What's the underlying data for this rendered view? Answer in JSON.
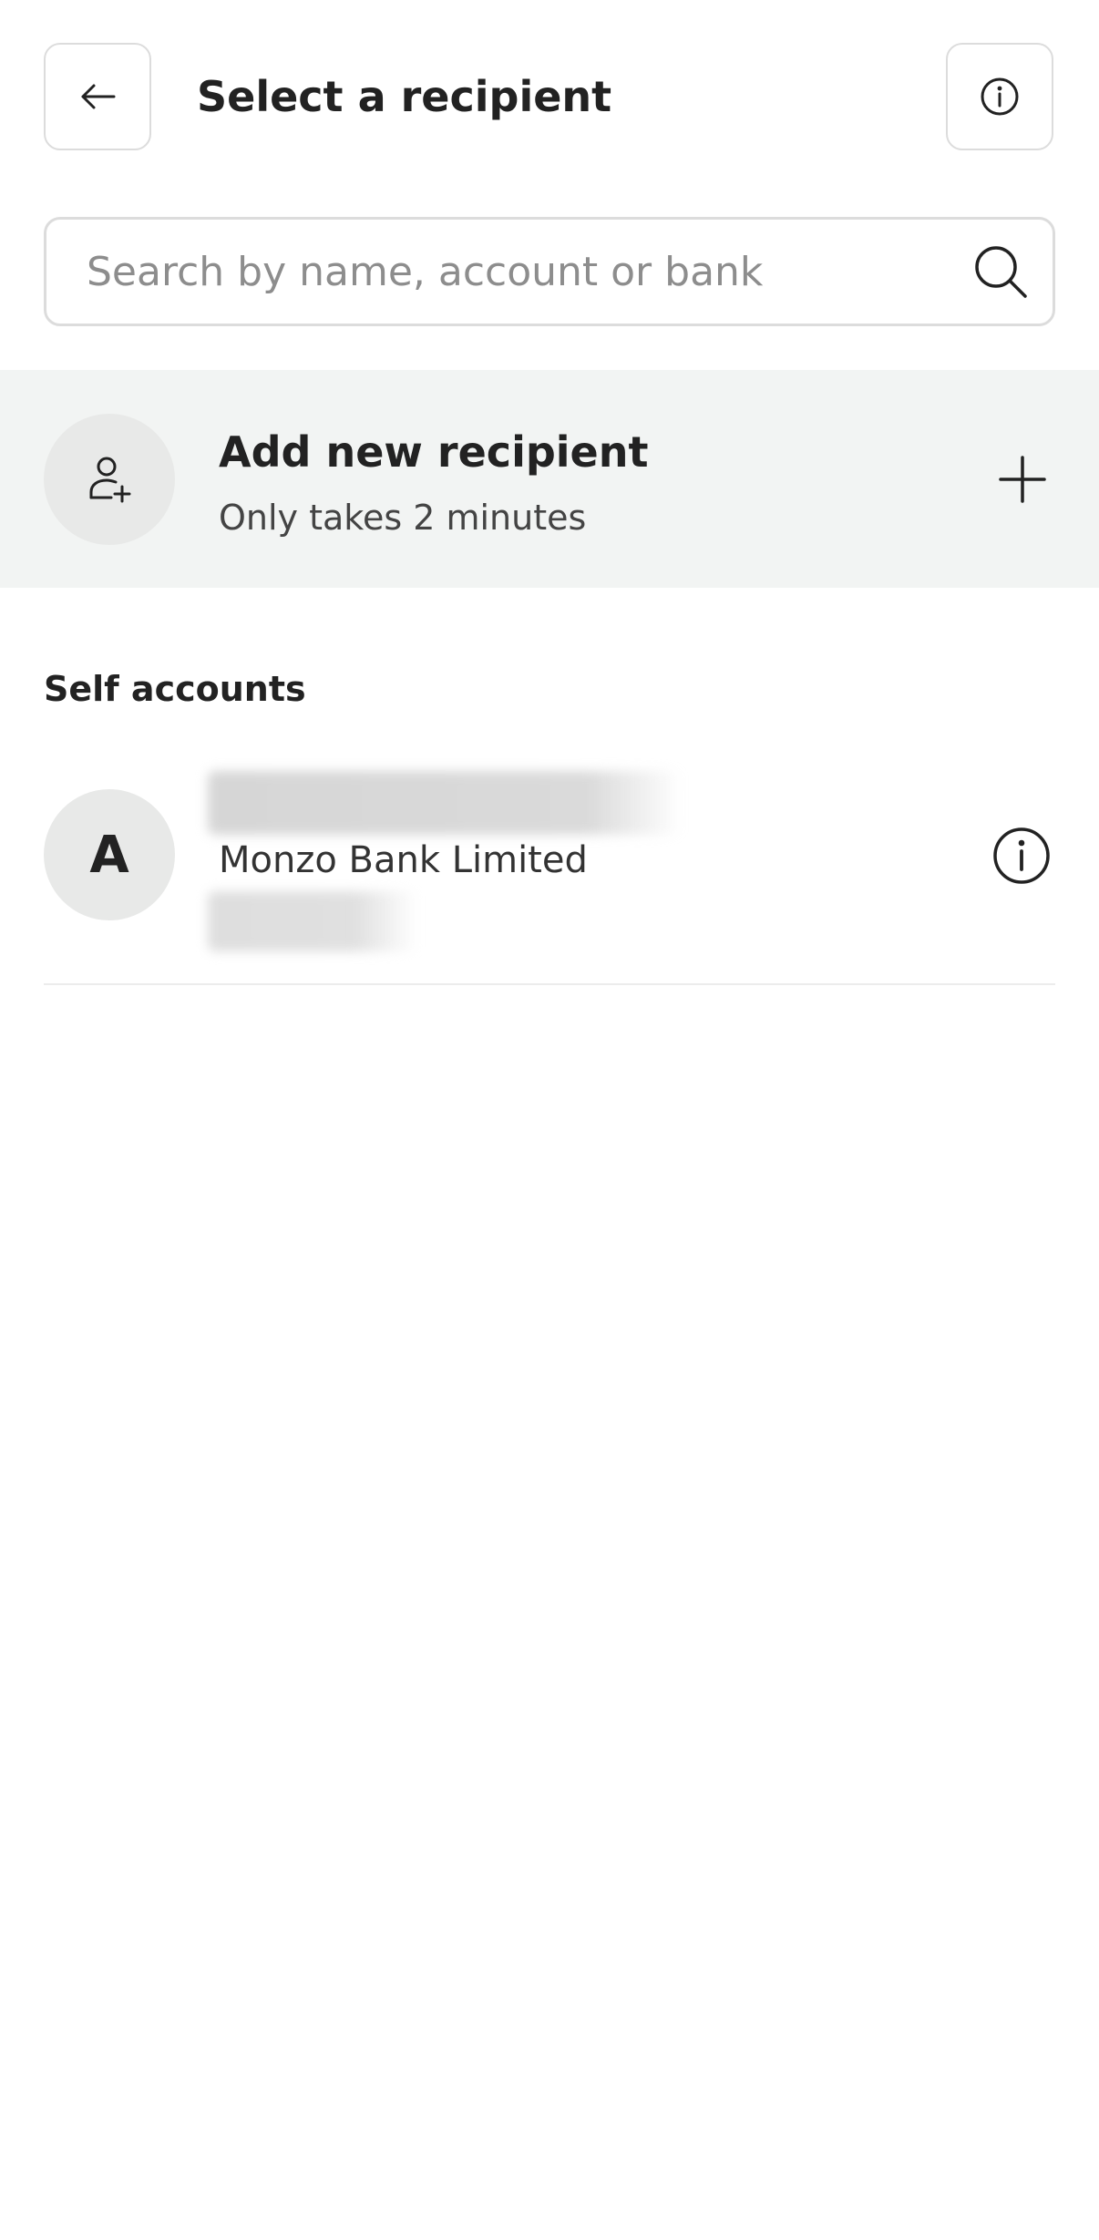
{
  "header": {
    "title": "Select a recipient",
    "back_icon": "arrow-left-icon",
    "info_icon": "info-icon"
  },
  "search": {
    "placeholder": "Search by name, account or bank",
    "value": "",
    "icon": "search-icon"
  },
  "add_recipient": {
    "title": "Add new recipient",
    "subtitle": "Only takes 2 minutes",
    "avatar_icon": "person-plus-icon",
    "action_icon": "plus-icon",
    "background": "#f2f4f3"
  },
  "self_accounts": {
    "section_title": "Self accounts",
    "items": [
      {
        "initial": "A",
        "bank": "Monzo Bank Limited",
        "info_icon": "info-icon"
      }
    ]
  },
  "colors": {
    "text": "#222222",
    "border": "#dcdcdc",
    "avatar_bg": "#e8e9e8"
  }
}
